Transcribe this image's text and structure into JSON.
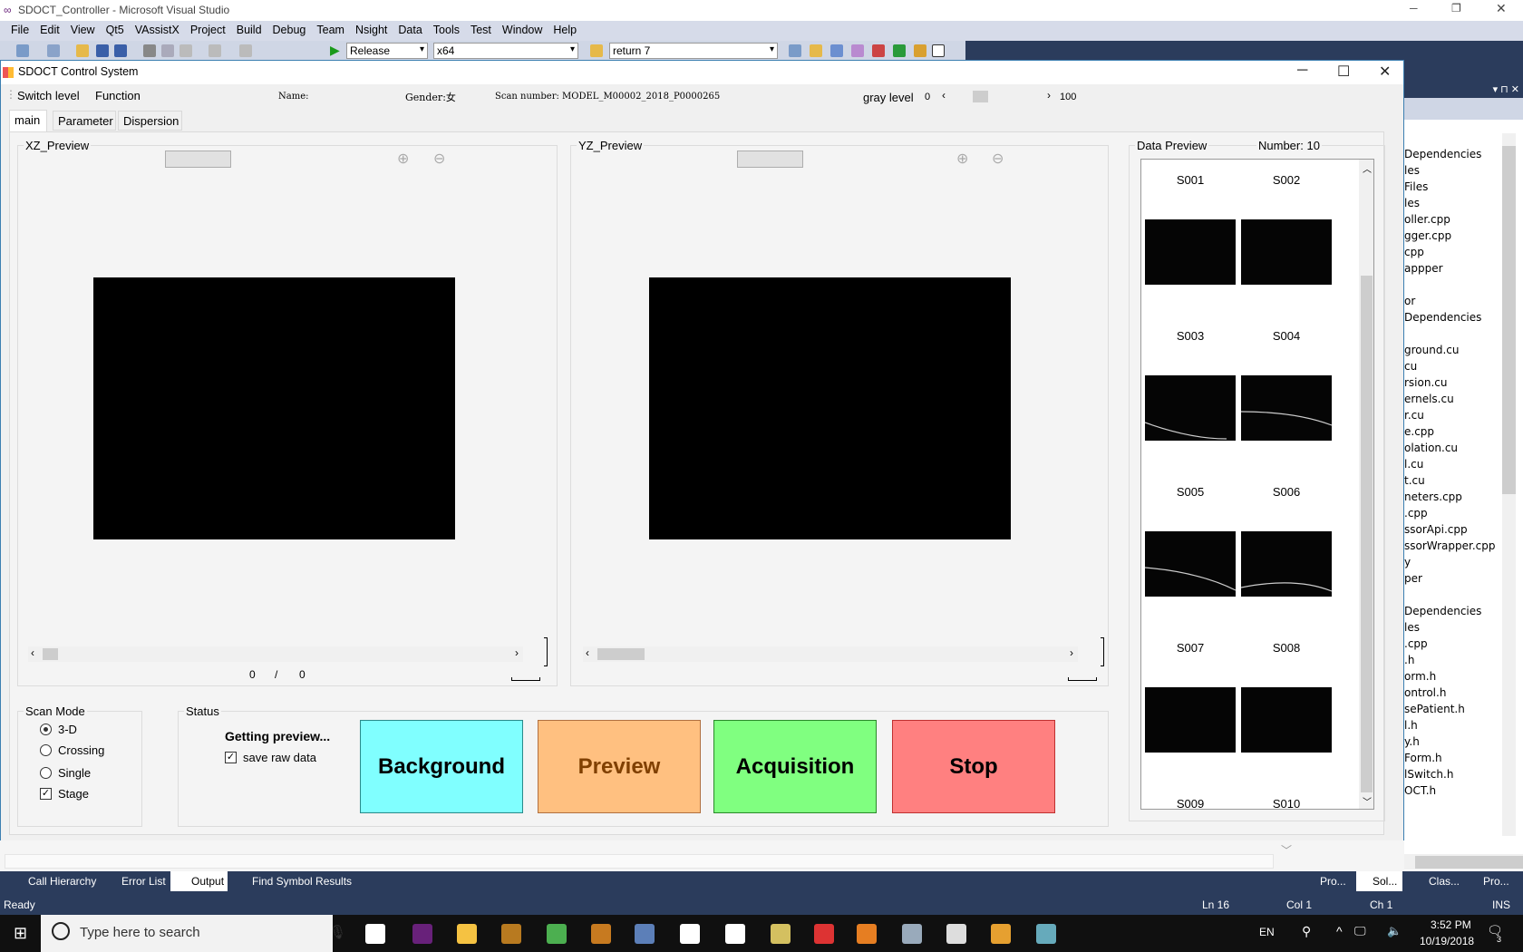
{
  "vs": {
    "title": "SDOCT_Controller - Microsoft Visual Studio",
    "menu": [
      "File",
      "Edit",
      "View",
      "Qt5",
      "VAssistX",
      "Project",
      "Build",
      "Debug",
      "Team",
      "Nsight",
      "Data",
      "Tools",
      "Test",
      "Window",
      "Help"
    ],
    "config": "Release",
    "platform": "x64",
    "find": "return 7"
  },
  "dialog": {
    "title": "SDOCT Control System",
    "menu": [
      "Switch level",
      "Function"
    ],
    "name_label": "Name:",
    "gender_label": "Gender:女",
    "scan_number": "Scan number: MODEL_M00002_2018_P0000265",
    "gray_level_label": "gray level",
    "gray_min": "0",
    "gray_max": "100",
    "gray_value_fraction": 0.3,
    "tabs": [
      "main",
      "Parameter",
      "Dispersion"
    ],
    "xz": {
      "title": "XZ_Preview",
      "counter_cur": "0",
      "counter_sep": "/",
      "counter_total": "0"
    },
    "yz": {
      "title": "YZ_Preview"
    },
    "data_preview": {
      "title": "Data Preview",
      "number": "Number: 10",
      "items": [
        "S001",
        "S002",
        "S003",
        "S004",
        "S005",
        "S006",
        "S007",
        "S008",
        "S009",
        "S010"
      ]
    },
    "scan_mode": {
      "title": "Scan Mode",
      "options": [
        "3-D",
        "Crossing",
        "Single"
      ],
      "selected": "3-D",
      "stage_label": "Stage",
      "stage_checked": true
    },
    "status": {
      "title": "Status",
      "message": "Getting preview...",
      "save_raw_label": "save raw data"
    },
    "buttons": {
      "background": "Background",
      "preview": "Preview",
      "acquisition": "Acquisition",
      "stop": "Stop"
    },
    "colors": {
      "background": "#80ffff",
      "preview": "#ffc080",
      "acquisition": "#80ff80",
      "stop": "#ff8080"
    }
  },
  "solution": [
    "Dependencies",
    "les",
    "Files",
    "les",
    "oller.cpp",
    "gger.cpp",
    "cpp",
    "appper",
    "",
    "or",
    "Dependencies",
    "",
    "ground.cu",
    "cu",
    "rsion.cu",
    "ernels.cu",
    "r.cu",
    "e.cpp",
    "olation.cu",
    "l.cu",
    "t.cu",
    "neters.cpp",
    ".cpp",
    "ssorApi.cpp",
    "ssorWrapper.cpp",
    "y",
    "per",
    "",
    "Dependencies",
    "les",
    ".cpp",
    ".h",
    "orm.h",
    "ontrol.h",
    "sePatient.h",
    "l.h",
    "y.h",
    "Form.h",
    "lSwitch.h",
    "OCT.h"
  ],
  "bottom_tabs": [
    "Call Hierarchy",
    "Error List",
    "Output",
    "Find Symbol Results"
  ],
  "right_tabs": [
    "Pro...",
    "Sol...",
    "Clas...",
    "Pro..."
  ],
  "statusbar": {
    "ready": "Ready",
    "ln": "Ln 16",
    "col": "Col 1",
    "ch": "Ch 1",
    "ins": "INS"
  },
  "taskbar": {
    "search_placeholder": "Type here to search",
    "lang": "EN",
    "time": "3:52 PM",
    "date": "10/19/2018",
    "notifications": "3"
  }
}
